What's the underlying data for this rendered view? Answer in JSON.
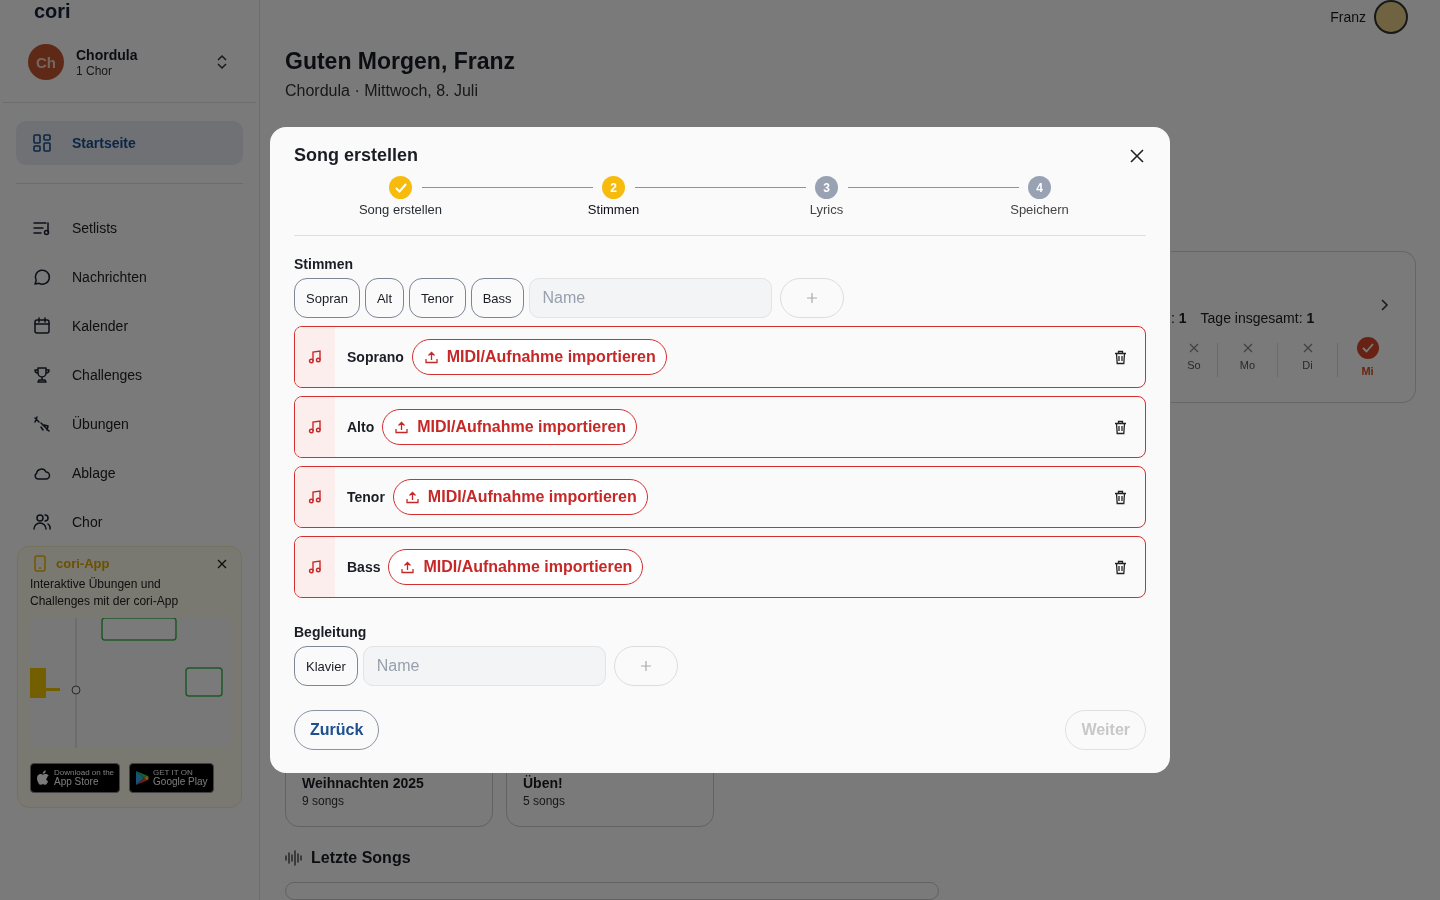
{
  "sidebar": {
    "logo": "cori",
    "org": {
      "initials": "Ch",
      "name": "Chordula",
      "subtitle": "1 Chor"
    },
    "home": {
      "label": "Startseite",
      "selected": true
    },
    "nav": [
      {
        "label": "Setlists",
        "selected": false
      },
      {
        "label": "Nachrichten",
        "selected": false
      },
      {
        "label": "Kalender",
        "selected": false
      },
      {
        "label": "Challenges",
        "selected": false
      },
      {
        "label": "Übungen",
        "selected": false
      },
      {
        "label": "Ablage",
        "selected": false
      },
      {
        "label": "Chor",
        "selected": false
      }
    ],
    "promo": {
      "title": "cori-App",
      "text": "Interaktive Übungen und Challenges mit der cori-App",
      "stores": [
        {
          "kind": "apple",
          "small": "Download on the",
          "big": "App Store"
        },
        {
          "kind": "google",
          "small": "GET IT ON",
          "big": "Google Play"
        }
      ]
    }
  },
  "header": {
    "user": "Franz"
  },
  "greeting": {
    "title": "Guten Morgen, Franz",
    "subtitle": "Chordula · Mittwoch, 8. Juli"
  },
  "streak": {
    "current_partial": ": **1**",
    "total": "Tage insgesamt: **1**",
    "days": [
      {
        "label": "So",
        "done": false
      },
      {
        "label": "Mo",
        "done": false
      },
      {
        "label": "Di",
        "done": false
      },
      {
        "label": "Mi",
        "done": true
      }
    ]
  },
  "setlists": [
    {
      "title": "Weihnachten 2025",
      "count": "9 songs"
    },
    {
      "title": "Üben!",
      "count": "5 songs"
    }
  ],
  "recent_songs": {
    "title": "Letzte Songs"
  },
  "modal": {
    "title": "Song erstellen",
    "steps": [
      {
        "label": "Song erstellen",
        "done": true,
        "selected": false
      },
      {
        "label": "Stimmen",
        "number": "2",
        "done": false,
        "selected": true
      },
      {
        "label": "Lyrics",
        "number": "3",
        "done": false,
        "selected": false
      },
      {
        "label": "Speichern",
        "number": "4",
        "done": false,
        "selected": false
      }
    ],
    "voices": {
      "label": "Stimmen",
      "presets": [
        "Sopran",
        "Alt",
        "Tenor",
        "Bass"
      ],
      "placeholder": "Name",
      "rows": [
        {
          "name": "Soprano",
          "action": "MIDI/Aufnahme importieren"
        },
        {
          "name": "Alto",
          "action": "MIDI/Aufnahme importieren"
        },
        {
          "name": "Tenor",
          "action": "MIDI/Aufnahme importieren"
        },
        {
          "name": "Bass",
          "action": "MIDI/Aufnahme importieren"
        }
      ]
    },
    "accompaniment": {
      "label": "Begleitung",
      "presets": [
        "Klavier"
      ],
      "placeholder": "Name"
    },
    "back": {
      "label": "Zurück",
      "disabled": false
    },
    "next": {
      "label": "Weiter",
      "disabled": true
    }
  }
}
